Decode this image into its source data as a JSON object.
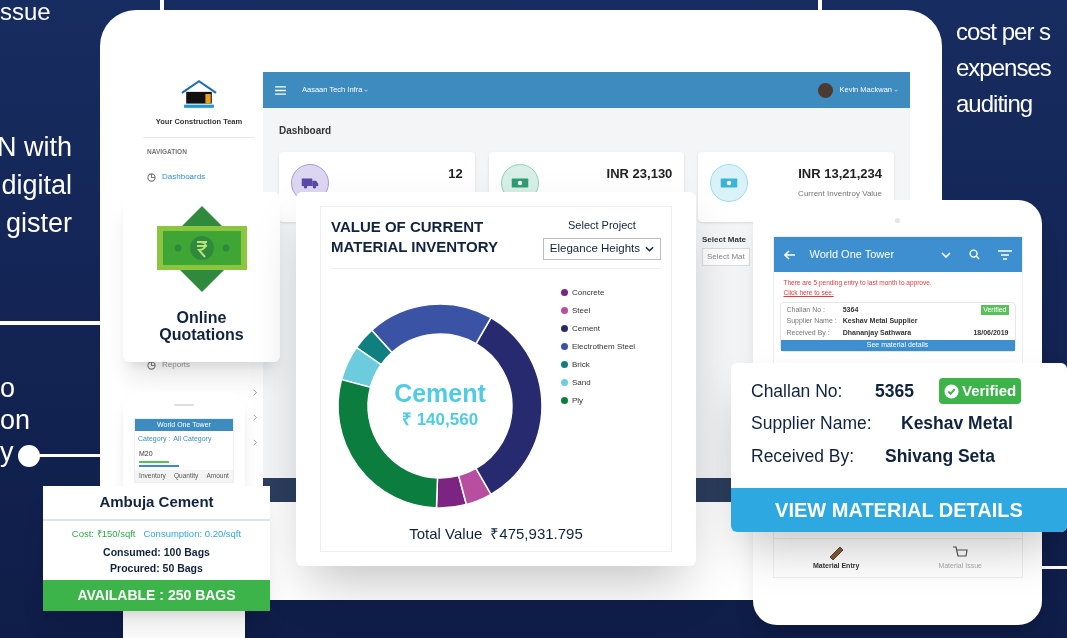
{
  "background_text": {
    "left_top": "ssue",
    "left_middle": [
      "N with",
      "digital",
      "gister"
    ],
    "left_bottom": [
      "o",
      "on",
      "y"
    ],
    "right_top": [
      "cost per s",
      "expenses",
      "auditing"
    ]
  },
  "dashboard": {
    "logo_caption": "Your Construction Team",
    "nav_heading": "NAVIGATION",
    "nav_items": [
      {
        "label": "Dashboards",
        "selected": true
      },
      {
        "label": "Reports",
        "selected": false
      }
    ],
    "company": "Aasaan Tech Infra",
    "user": "Kevin Mackwan",
    "page_title": "Dashboard",
    "stats": [
      {
        "value": "12"
      },
      {
        "value": "INR 23,130"
      },
      {
        "value": "INR 13,21,234",
        "caption": "Current Inventroy Value"
      }
    ],
    "select_label": "Select Mate",
    "select_placeholder": "Select Mat"
  },
  "quotations_card": {
    "title": "Online Quotations"
  },
  "inventory_card": {
    "title": "VALUE OF CURRENT MATERIAL INVENTORY",
    "select_label": "Select Project",
    "project": "Elegance Heights",
    "legend": [
      {
        "name": "Concrete",
        "color": "#7b2482"
      },
      {
        "name": "Steel",
        "color": "#b84ea0"
      },
      {
        "name": "Cement",
        "color": "#272a6e"
      },
      {
        "name": "Electrothem Steel",
        "color": "#3a53a4"
      },
      {
        "name": "Brick",
        "color": "#0f7f80"
      },
      {
        "name": "Sand",
        "color": "#6ccbdc"
      },
      {
        "name": "Ply",
        "color": "#0b7d3e"
      }
    ],
    "center_label": "Cement",
    "center_value": "₹ 140,560",
    "total_label": "Total Value",
    "total_value": "₹475,931.795"
  },
  "mini_phone": {
    "title": "World One Tower",
    "category_label": "Category :",
    "category": "All Category",
    "item": "M20",
    "columns": [
      "Inventory",
      "Quantity",
      "Amount"
    ]
  },
  "material_card": {
    "name": "Ambuja Cement",
    "cost": "Cost: ₹150/sqft",
    "consumption": "Consumption: 0.20/sqft",
    "consumed": "Consumed: 100 Bags",
    "procured": "Procured: 50 Bags",
    "available": "AVAILABLE : 250 BAGS"
  },
  "tablet": {
    "title": "World One Tower",
    "alert": "There are 5 pending entry to last month to approve.",
    "alert_link": "Click here to see.",
    "entry": {
      "challan_label": "Challan No :",
      "challan": "5364",
      "supplier_label": "Supplier Name :",
      "supplier": "Keshav Metal Supplier",
      "received_label": "Received By :",
      "received": "Dhananjay Sathwara",
      "status": "Verified",
      "date": "18/06/2019",
      "action": "See material details"
    },
    "tabs": [
      {
        "label": "Material Entry",
        "selected": true
      },
      {
        "label": "Material Issue",
        "selected": false
      }
    ]
  },
  "challan_card": {
    "challan_label": "Challan No:",
    "challan": "5365",
    "status": "Verified",
    "supplier_label": "Supplier Name:",
    "supplier": "Keshav Metal",
    "received_label": "Received By:",
    "received": "Shivang Seta",
    "action": "VIEW MATERIAL DETAILS"
  }
}
